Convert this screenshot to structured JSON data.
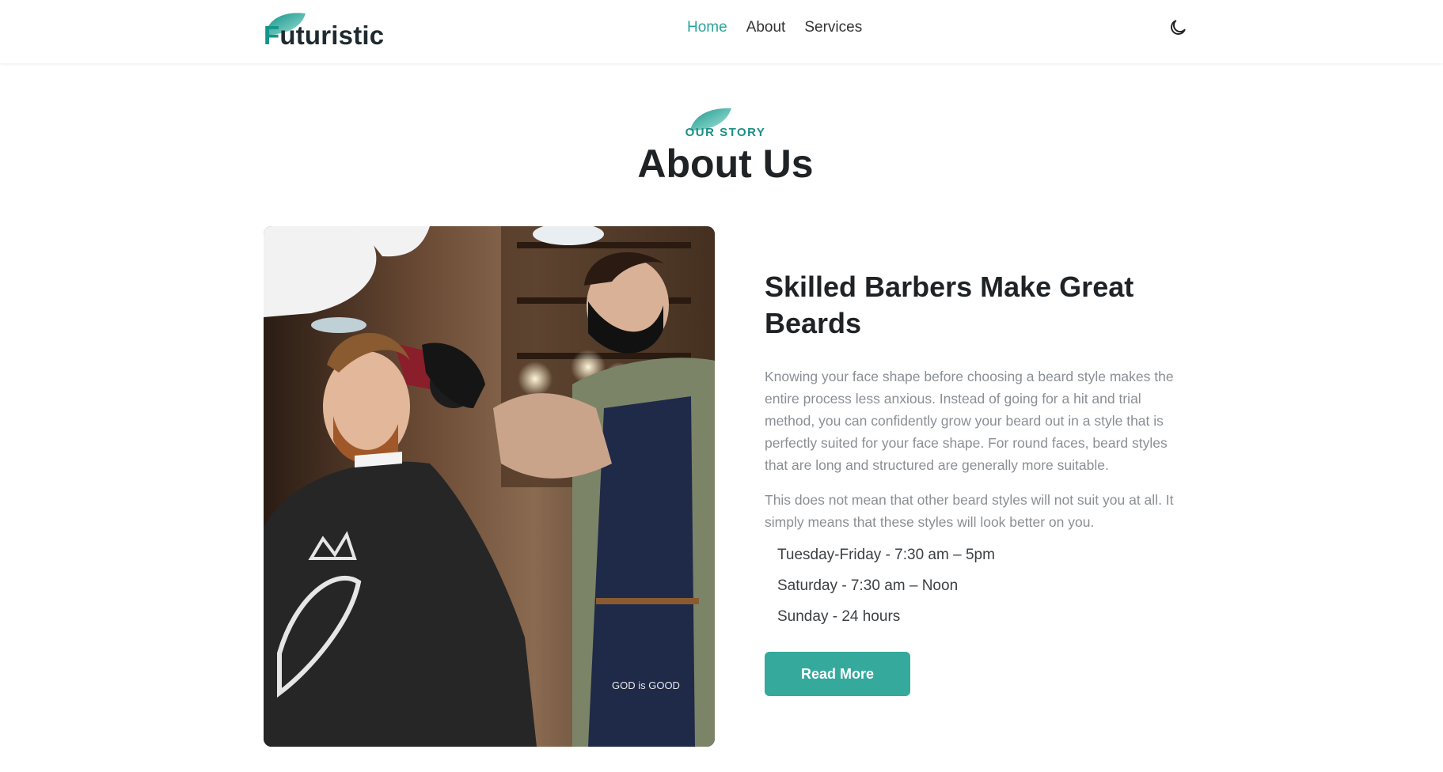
{
  "brand": {
    "logo_first_letter": "F",
    "logo_rest": "uturistic",
    "accent_color": "#2aa59a",
    "button_color": "#34a99c"
  },
  "nav": {
    "items": [
      {
        "label": "Home",
        "active": true
      },
      {
        "label": "About",
        "active": false
      },
      {
        "label": "Services",
        "active": false
      }
    ],
    "theme_toggle_icon": "moon-icon"
  },
  "section": {
    "eyebrow": "OUR STORY",
    "title": "About Us"
  },
  "image": {
    "subject": "barber-photo",
    "apron_text": "GOD is GOOD"
  },
  "about": {
    "heading": "Skilled Barbers Make Great Beards",
    "paragraph1": "Knowing your face shape before choosing a beard style makes the entire process less anxious. Instead of going for a hit and trial method, you can confidently grow your beard out in a style that is perfectly suited for your face shape. For round faces, beard styles that are long and structured are generally more suitable.",
    "paragraph2": "This does not mean that other beard styles will not suit you at all. It simply means that these styles will look better on you.",
    "hours": [
      "Tuesday-Friday - 7:30 am – 5pm",
      "Saturday - 7:30 am – Noon",
      "Sunday - 24 hours"
    ],
    "button_label": "Read More"
  }
}
